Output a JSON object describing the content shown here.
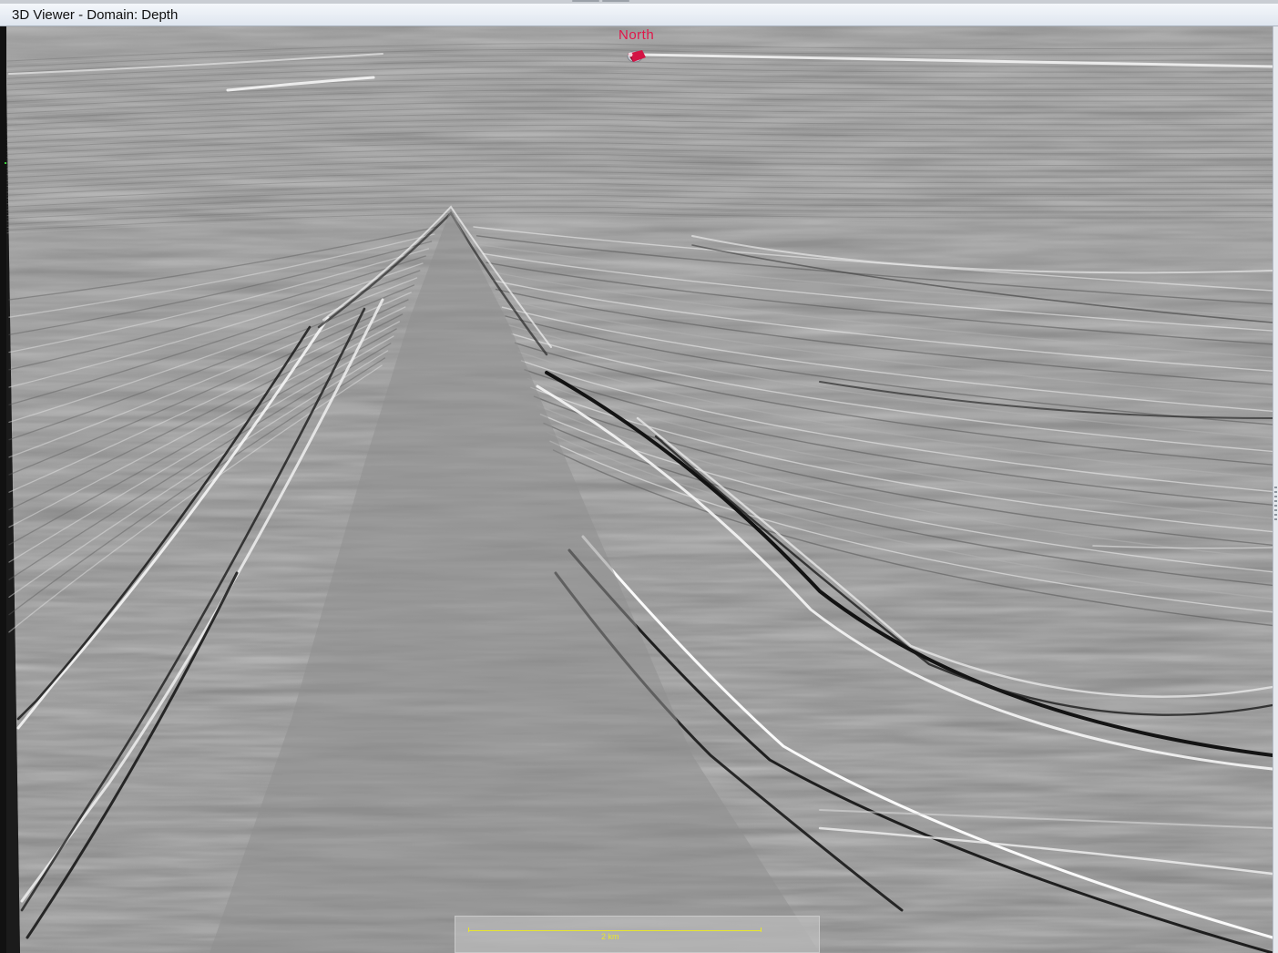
{
  "window": {
    "title": "3D Viewer - Domain: Depth"
  },
  "viewer": {
    "compass_label": "North",
    "compass_icon": "north-arrow-icon",
    "scale_bar_label": "2 km",
    "colors": {
      "compass": "#e0174a",
      "scale_bar": "#e8e62c",
      "seismic_background": "#8e8e8e"
    }
  }
}
